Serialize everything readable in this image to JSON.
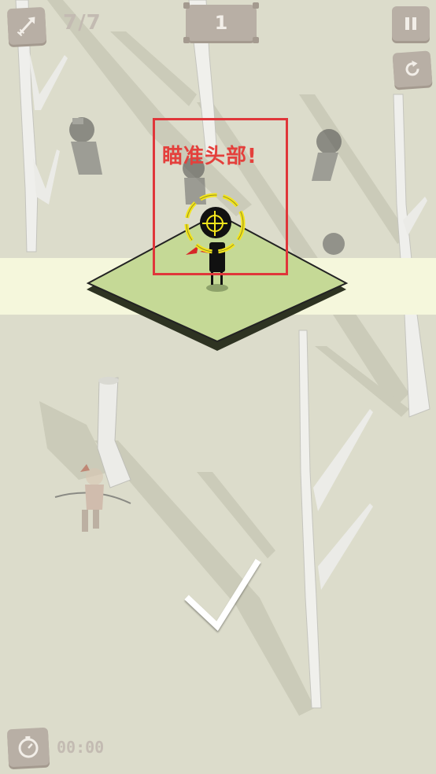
{
  "hud": {
    "ammo_count": "7/7",
    "level_number": "1",
    "timer": "00:00"
  },
  "tutorial": {
    "hint": "瞄准头部!"
  },
  "icons": {
    "weapon": "arrow-icon",
    "pause": "pause-icon",
    "restart": "restart-icon",
    "timer": "stopwatch-icon",
    "confirm": "checkmark-icon",
    "aim": "crosshair-icon"
  },
  "colors": {
    "background": "#dcdccb",
    "highlight_band": "#f5f7dc",
    "platform": "#c5d996",
    "hud_button": "#b8afa5",
    "hint_red": "#e4403c",
    "crosshair_yellow": "#f3e51c"
  }
}
